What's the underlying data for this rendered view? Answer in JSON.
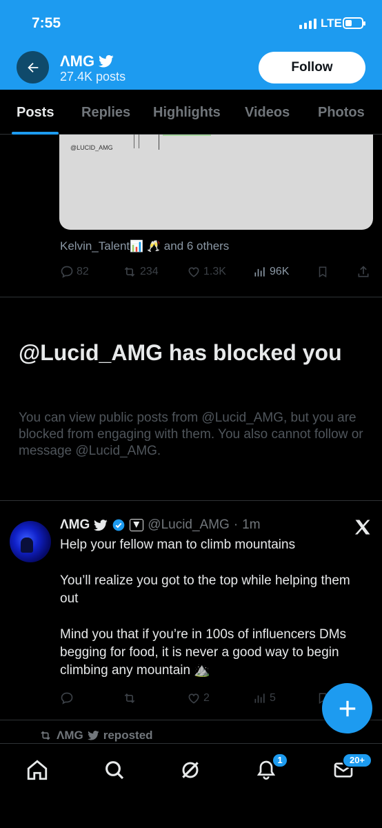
{
  "status_bar": {
    "time": "7:55",
    "network": "LTE"
  },
  "header": {
    "display_name": "ɅMG",
    "post_count": "27.4K posts",
    "follow_label": "Follow",
    "accent_color": "#1d9bf0"
  },
  "tabs": [
    {
      "label": "Posts",
      "active": true
    },
    {
      "label": "Replies",
      "active": false
    },
    {
      "label": "Highlights",
      "active": false
    },
    {
      "label": "Videos",
      "active": false
    },
    {
      "label": "Photos",
      "active": false
    }
  ],
  "previous_post": {
    "image_watermark": "@LUCID_AMG",
    "liked_by_name": "Kelvin_Talent",
    "liked_by_emojis": "📊 🥂",
    "liked_by_rest": "and 6 others",
    "stats": {
      "replies": "82",
      "reposts": "234",
      "likes": "1.3K",
      "views": "96K"
    }
  },
  "blocked_notice": {
    "title": "@Lucid_AMG has blocked you",
    "description": "You can view public posts from @Lucid_AMG, but you are blocked from engaging with them. You also cannot follow or message @Lucid_AMG."
  },
  "tweet": {
    "display_name": "ɅMG",
    "handle": "@Lucid_AMG",
    "time": "1m",
    "paragraphs": [
      "Help your fellow man to climb mountains",
      "You’ll realize you got to the top while helping them out",
      "Mind you that if you’re in 100s of influencers DMs begging for food, it is never a good way to begin climbing any mountain ⛰️"
    ],
    "stats": {
      "likes": "2",
      "views": "5"
    }
  },
  "repost_context": {
    "name": "ɅMG",
    "label": "reposted"
  },
  "bottom_nav": {
    "notifications_badge": "1",
    "messages_badge": "20+"
  }
}
